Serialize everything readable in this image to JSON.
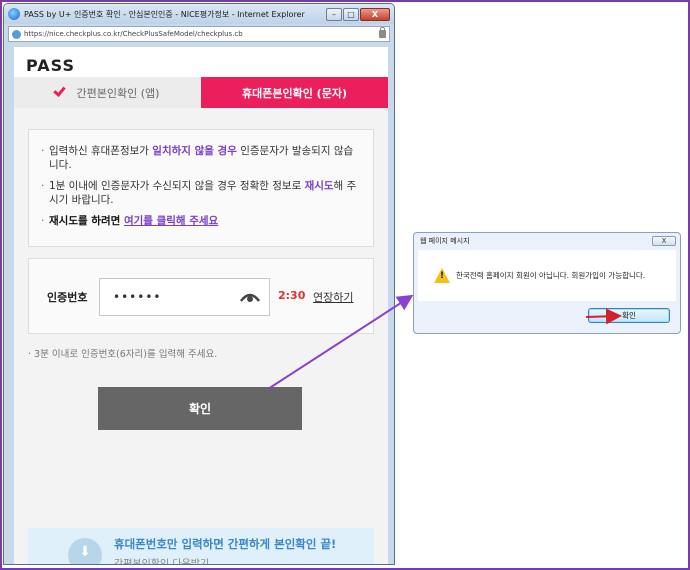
{
  "browser": {
    "title": "PASS by U+ 인증번호 확인 - 안심본인인증 - NICE평가정보 - Internet Explorer",
    "url": "https://nice.checkplus.co.kr/CheckPlusSafeModel/checkplus.cb",
    "window_buttons": {
      "minimize": "–",
      "maximize": "□",
      "close": "X"
    }
  },
  "page": {
    "logo": "PASS",
    "tabs": [
      {
        "label": "간편본인확인 (앱)",
        "active": false
      },
      {
        "label": "휴대폰본인확인 (문자)",
        "active": true
      }
    ],
    "notice": {
      "item1_part1": "입력하신 휴대폰정보가 ",
      "item1_highlight": "일치하지 않을 경우",
      "item1_part2": " 인증문자가 발송되지 않습니다.",
      "item2_part1": "1분 이내에 인증문자가 수신되지 않을 경우 정확한 정보로 ",
      "item2_highlight": "재시도",
      "item2_part2": "해 주시기 바랍니다.",
      "item3_part1": "재시도를 하려면 ",
      "item3_link": "여기를 클릭해 주세요"
    },
    "code": {
      "label": "인증번호",
      "value": "••••••",
      "timer": "2:30",
      "extend_label": "연장하기"
    },
    "help_text": "3분 이내로 인증번호(6자리)를 입력해 주세요.",
    "confirm_label": "확인",
    "promo": {
      "main": "휴대폰번호만 입력하면 간편하게 본인확인 끝!",
      "sub": "간편본인확인 다운받기"
    }
  },
  "dialog": {
    "title": "웹 페이지 메시지",
    "close_label": "X",
    "message": "한국전력 홈페이지 회원이 아닙니다. 회원가입이 가능합니다.",
    "ok_label": "확인"
  },
  "colors": {
    "accent_pink": "#ea1f5b",
    "highlight_purple": "#7b3fc9",
    "timer_red": "#e0302f",
    "annotation_purple": "#8a3fd0",
    "annotation_red": "#d3202b"
  }
}
